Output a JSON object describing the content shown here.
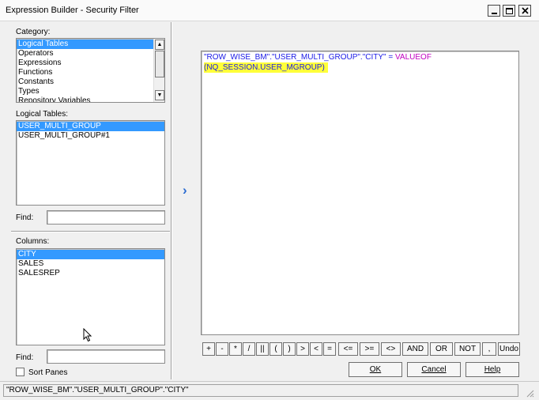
{
  "window": {
    "title": "Expression Builder - Security Filter",
    "controls": {
      "minimize": "_",
      "maximize": "□",
      "close": "✕"
    }
  },
  "category": {
    "label": "Category:",
    "items": [
      "Logical Tables",
      "Operators",
      "Expressions",
      "Functions",
      "Constants",
      "Types",
      "Repository Variables"
    ],
    "selected_index": 0
  },
  "logical_tables": {
    "label": "Logical Tables:",
    "items": [
      "USER_MULTI_GROUP",
      "USER_MULTI_GROUP#1"
    ],
    "selected_index": 0,
    "find_label": "Find:",
    "find_value": ""
  },
  "columns": {
    "label": "Columns:",
    "items": [
      "CITY",
      "SALES",
      "SALESREP"
    ],
    "selected_index": 0,
    "find_label": "Find:",
    "find_value": ""
  },
  "sort_panes": {
    "label": "Sort Panes",
    "checked": false
  },
  "insert_arrow": "›",
  "expression": {
    "part1": "\"ROW_WISE_BM\".\"USER_MULTI_GROUP\".\"CITY\" = ",
    "keyword": "VALUEOF",
    "part2": "(NQ_SESSION.USER_MGROUP)",
    "highlight_color": "#ffff3a"
  },
  "operators": [
    "+",
    "-",
    "*",
    "/",
    "||",
    "(",
    ")",
    ">",
    "<",
    "=",
    "<=",
    ">=",
    "<>",
    "AND",
    "OR",
    "NOT",
    ",",
    "Undo"
  ],
  "buttons": {
    "ok": "OK",
    "cancel": "Cancel",
    "help": "Help"
  },
  "status": "\"ROW_WISE_BM\".\"USER_MULTI_GROUP\".\"CITY\"",
  "colors": {
    "selection": "#3399ff",
    "keyword": "#c000c0",
    "identifier": "#1a1ae6"
  }
}
